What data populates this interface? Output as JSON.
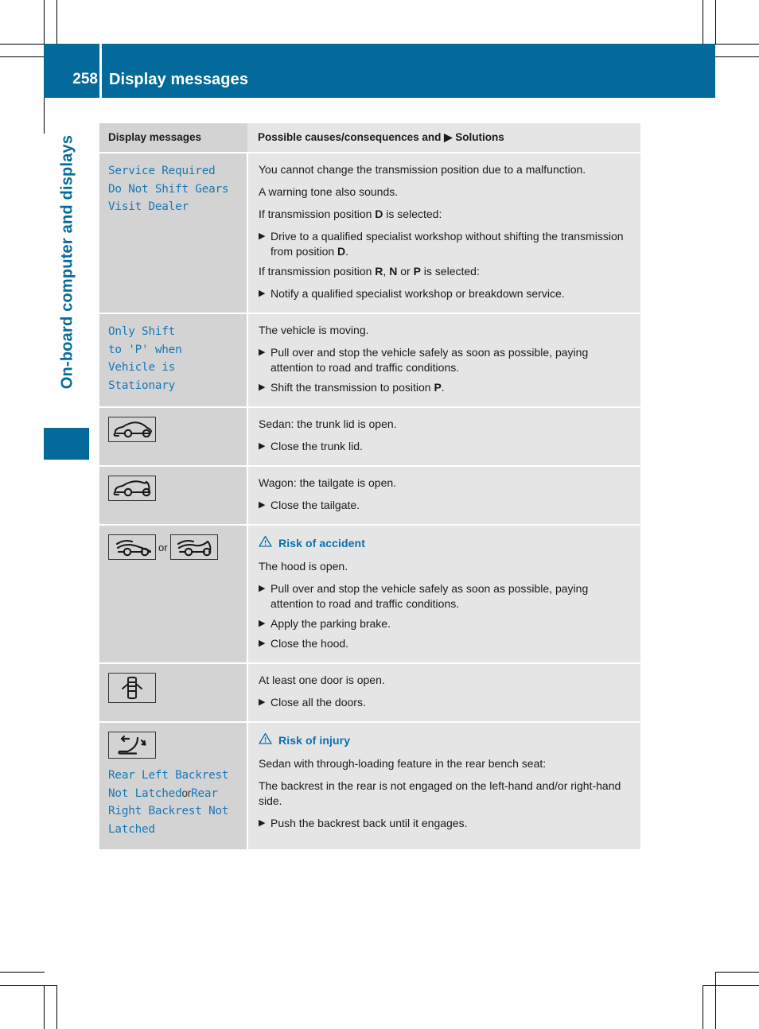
{
  "header": {
    "page_number": "258",
    "title": "Display messages"
  },
  "side_tab": {
    "label": "On-board computer and displays"
  },
  "table": {
    "columns": [
      {
        "label": "Display messages"
      },
      {
        "label": "Possible causes/consequences and ▶ Solutions"
      }
    ],
    "rows": [
      {
        "message": "Service Required\nDo Not Shift Gears\nVisit Dealer",
        "blocks": [
          {
            "type": "p",
            "text": "You cannot change the transmission position due to a malfunction."
          },
          {
            "type": "p",
            "text": "A warning tone also sounds."
          },
          {
            "type": "p_rich",
            "pre": "If transmission position ",
            "bold": "D",
            "post": " is selected:"
          },
          {
            "type": "step_rich",
            "pre": "Drive to a qualified specialist workshop without shifting the transmission from position ",
            "bold": "D",
            "post": "."
          },
          {
            "type": "p_rich3",
            "pre": "If transmission position ",
            "b1": "R",
            "mid1": ", ",
            "b2": "N",
            "mid2": " or ",
            "b3": "P",
            "post": " is selected:"
          },
          {
            "type": "step",
            "text": "Notify a qualified specialist workshop or breakdown service."
          }
        ]
      },
      {
        "message": "Only Shift\nto 'P' when\nVehicle is\nStationary",
        "blocks": [
          {
            "type": "p",
            "text": "The vehicle is moving."
          },
          {
            "type": "step",
            "text": "Pull over and stop the vehicle safely as soon as possible, paying attention to road and traffic conditions."
          },
          {
            "type": "step_rich",
            "pre": "Shift the transmission to position ",
            "bold": "P",
            "post": "."
          }
        ]
      },
      {
        "icons": [
          "sedan-trunk-open-icon"
        ],
        "blocks": [
          {
            "type": "p",
            "text": "Sedan: the trunk lid is open."
          },
          {
            "type": "step",
            "text": "Close the trunk lid."
          }
        ]
      },
      {
        "icons": [
          "wagon-tailgate-open-icon"
        ],
        "blocks": [
          {
            "type": "p",
            "text": "Wagon: the tailgate is open."
          },
          {
            "type": "step",
            "text": "Close the tailgate."
          }
        ]
      },
      {
        "icons": [
          "sedan-hood-open-icon",
          "wagon-hood-open-icon"
        ],
        "icon_separator": "or",
        "warning": "Risk of accident",
        "blocks": [
          {
            "type": "p",
            "text": "The hood is open."
          },
          {
            "type": "step",
            "text": "Pull over and stop the vehicle safely as soon as possible, paying attention to road and traffic conditions."
          },
          {
            "type": "step",
            "text": "Apply the parking brake."
          },
          {
            "type": "step",
            "text": "Close the hood."
          }
        ]
      },
      {
        "icons": [
          "door-open-top-view-icon"
        ],
        "blocks": [
          {
            "type": "p",
            "text": "At least one door is open."
          },
          {
            "type": "step",
            "text": "Close all the doors."
          }
        ]
      },
      {
        "icons": [
          "backrest-not-latched-icon"
        ],
        "message_parts": [
          {
            "text": "Rear Left Backrest\nNot Latched",
            "style": "mono"
          },
          {
            "text": "or",
            "style": "plain"
          },
          {
            "text": "Rear Right Backrest Not Latched",
            "style": "mono"
          }
        ],
        "warning": "Risk of injury",
        "blocks": [
          {
            "type": "p",
            "text": "Sedan with through-loading feature in the rear bench seat:"
          },
          {
            "type": "p",
            "text": "The backrest in the rear is not engaged on the left-hand and/or right-hand side."
          },
          {
            "type": "step",
            "text": "Push the backrest back until it engages."
          }
        ]
      }
    ]
  },
  "colors": {
    "brand_blue": "#046a9c",
    "message_blue": "#1679b6",
    "warning_blue": "#0a71ab",
    "col_left_bg": "#d3d3d3",
    "col_right_bg": "#e5e5e5"
  }
}
